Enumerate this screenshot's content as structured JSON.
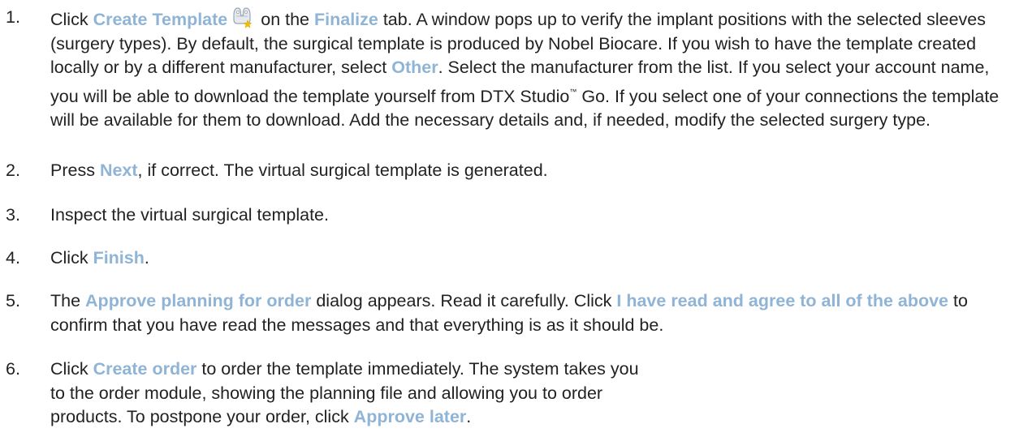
{
  "steps": [
    {
      "num": "1.",
      "parts": {
        "t1": "Click ",
        "b1": "Create Template",
        "icon": "surgical-template-icon",
        "t2": " on the ",
        "b2": "Finalize",
        "t3": " tab. A window pops up to verify the implant positions with the selected sleeves (surgery types). By default, the surgical template is produced by Nobel Biocare. If you wish to have the template created locally or by a different manufacturer, select ",
        "b3": "Other",
        "t4": ". Select the manufacturer from the list. If you select your account name, you will be able to download the template yourself from DTX Studio",
        "tm": "™",
        "t5": " Go. If you select one of your connections the template will be available for them to download. Add the necessary details and, if needed, modify the selected surgery type."
      }
    },
    {
      "num": "2.",
      "parts": {
        "t1": "Press ",
        "b1": "Next",
        "t2": ", if correct. The virtual surgical template is generated."
      }
    },
    {
      "num": "3.",
      "parts": {
        "t1": "Inspect the virtual surgical template."
      }
    },
    {
      "num": "4.",
      "parts": {
        "t1": "Click ",
        "b1": "Finish",
        "t2": "."
      }
    },
    {
      "num": "5.",
      "parts": {
        "t1": "The ",
        "b1": "Approve planning for order",
        "t2": " dialog appears. Read it carefully. Click ",
        "b2": "I have read and agree to all of the above",
        "t3": " to confirm that you have read the messages and that everything is as it should be."
      }
    },
    {
      "num": "6.",
      "parts": {
        "t1": "Click ",
        "b1": "Create order",
        "t2": " to order the template immediately. The system takes you to the order module, showing the planning file and allowing you to order products. To postpone your order, click ",
        "b2": "Approve later",
        "t3": "."
      }
    }
  ],
  "colors": {
    "ui_label": "#8fb4d6",
    "body_text": "#222222",
    "icon_star": "#f2c200"
  }
}
